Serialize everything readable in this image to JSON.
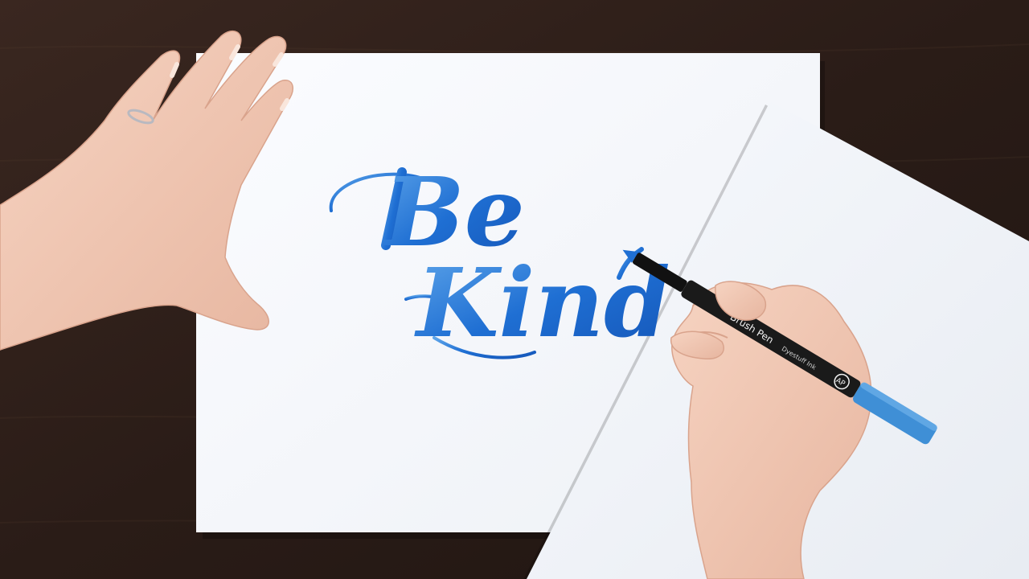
{
  "lettering": {
    "line1": "Be",
    "line2": "Kind"
  },
  "pen": {
    "label": "Brush Pen",
    "sublabel": "Dyestuff Ink",
    "badge": "AP",
    "cap_color": "#3f8fd6",
    "body_color": "#1a1a1a"
  },
  "colors": {
    "ink_blue": "#1f6fd3",
    "desk": "#2a1c17",
    "paper": "#f7f8fb",
    "skin": "#f2c9b5"
  }
}
